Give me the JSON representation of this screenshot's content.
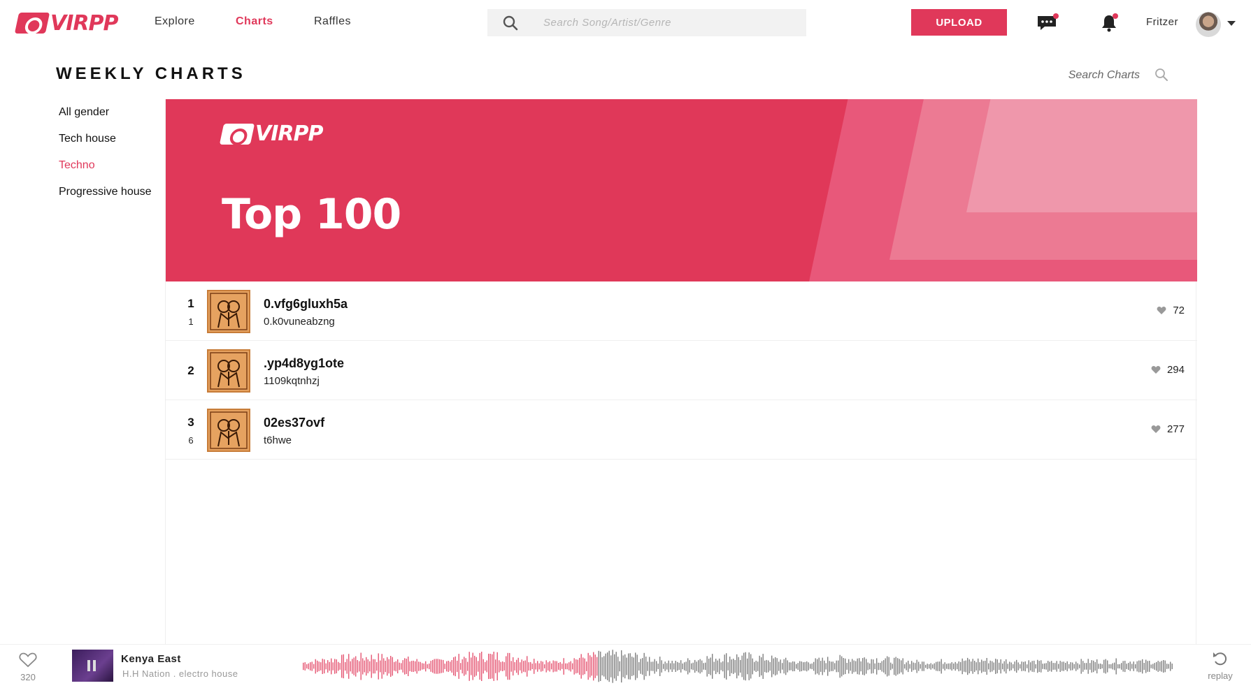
{
  "brand": {
    "name": "VIRPP",
    "accent": "#e0385a"
  },
  "nav": {
    "links": [
      {
        "label": "Explore",
        "active": false
      },
      {
        "label": "Charts",
        "active": true
      },
      {
        "label": "Raffles",
        "active": false
      }
    ],
    "search_placeholder": "Search Song/Artist/Genre",
    "upload_label": "UPLOAD",
    "messages_icon": "chat-bubble-icon",
    "notifications_icon": "bell-icon",
    "user_name": "Fritzer"
  },
  "page": {
    "title": "WEEKLY CHARTS",
    "chart_search_placeholder": "Search Charts"
  },
  "sidebar": {
    "genres": [
      {
        "label": "All gender",
        "active": false
      },
      {
        "label": "Tech house",
        "active": false
      },
      {
        "label": "Techno",
        "active": true
      },
      {
        "label": "Progressive house",
        "active": false
      }
    ]
  },
  "banner": {
    "logo_text": "VIRPP",
    "title": "Top 100"
  },
  "tracks": [
    {
      "rank": "1",
      "previous_rank": "1",
      "title": "0.vfg6gluxh5a",
      "artist": "0.k0vuneabzng",
      "likes": "72"
    },
    {
      "rank": "2",
      "previous_rank": "",
      "title": ".yp4d8yg1ote",
      "artist": "1109kqtnhzj",
      "likes": "294"
    },
    {
      "rank": "3",
      "previous_rank": "6",
      "title": "02es37ovf",
      "artist": "t6hwe",
      "likes": "277"
    }
  ],
  "player": {
    "likes": "320",
    "title": "Kenya East",
    "meta": "H.H Nation . electro house",
    "progress": 0.34,
    "played_color": "#e0385a",
    "unplayed_color": "#555555",
    "replay_label": "replay"
  }
}
